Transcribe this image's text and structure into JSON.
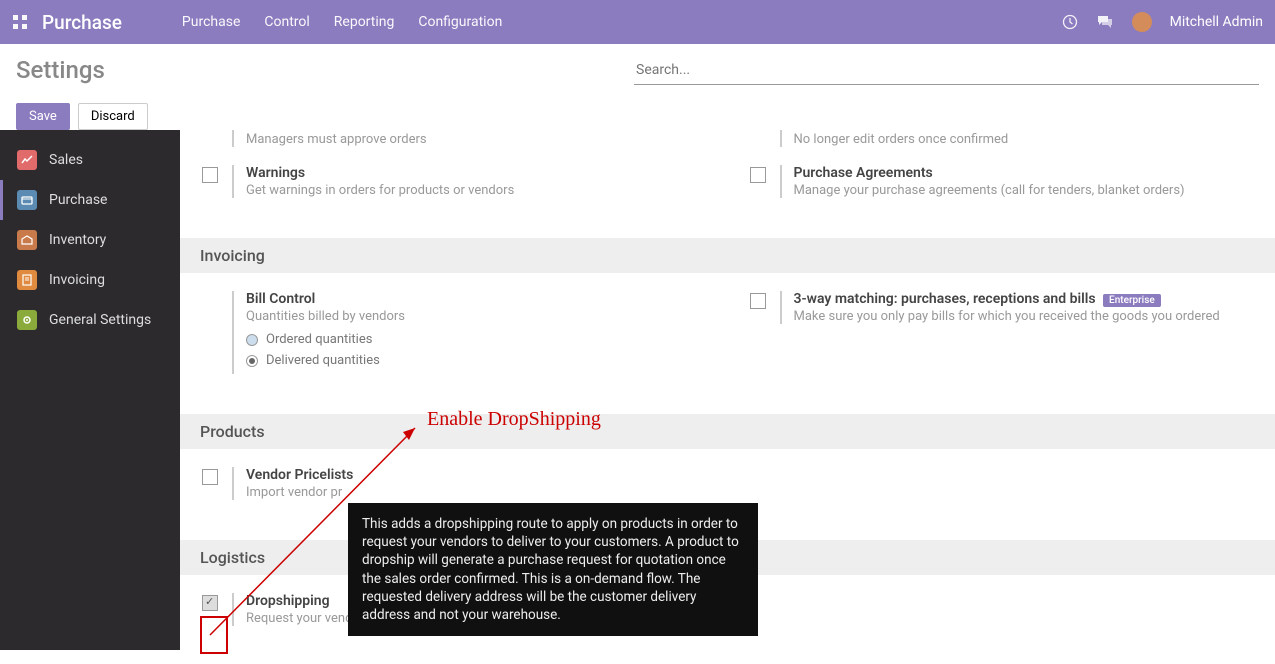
{
  "topbar": {
    "app_name": "Purchase",
    "menu": [
      "Purchase",
      "Control",
      "Reporting",
      "Configuration"
    ],
    "user_name": "Mitchell Admin"
  },
  "subheader": {
    "title": "Settings",
    "search_placeholder": "Search...",
    "save_label": "Save",
    "discard_label": "Discard"
  },
  "sidebar": {
    "items": [
      {
        "label": "Sales"
      },
      {
        "label": "Purchase"
      },
      {
        "label": "Inventory"
      },
      {
        "label": "Invoicing"
      },
      {
        "label": "General Settings"
      }
    ]
  },
  "orders": {
    "left_truncated_desc": "Managers must approve orders",
    "right_truncated_desc": "No longer edit orders once confirmed",
    "warnings_title": "Warnings",
    "warnings_desc": "Get warnings in orders for products or vendors",
    "pa_title": "Purchase Agreements",
    "pa_desc": "Manage your purchase agreements (call for tenders, blanket orders)"
  },
  "invoicing": {
    "header": "Invoicing",
    "bill_control_title": "Bill Control",
    "bill_control_desc": "Quantities billed by vendors",
    "radio_ordered": "Ordered quantities",
    "radio_delivered": "Delivered quantities",
    "threeway_title": "3-way matching: purchases, receptions and bills",
    "threeway_badge": "Enterprise",
    "threeway_desc": "Make sure you only pay bills for which you received the goods you ordered"
  },
  "products": {
    "header": "Products",
    "vendor_pricelist_title": "Vendor Pricelists",
    "vendor_pricelist_desc_truncated": "Import vendor pr"
  },
  "logistics": {
    "header": "Logistics",
    "dropship_title": "Dropshipping",
    "dropship_desc": "Request your vendors to deliver to your customers"
  },
  "annotation": {
    "label": "Enable  DropShipping",
    "tooltip": "This adds a dropshipping route to apply on products in order to request your vendors to deliver to your customers. A product to dropship will generate a purchase request for quotation once the sales order confirmed. This is a on-demand flow. The requested delivery address will be the customer delivery address and not your warehouse."
  }
}
